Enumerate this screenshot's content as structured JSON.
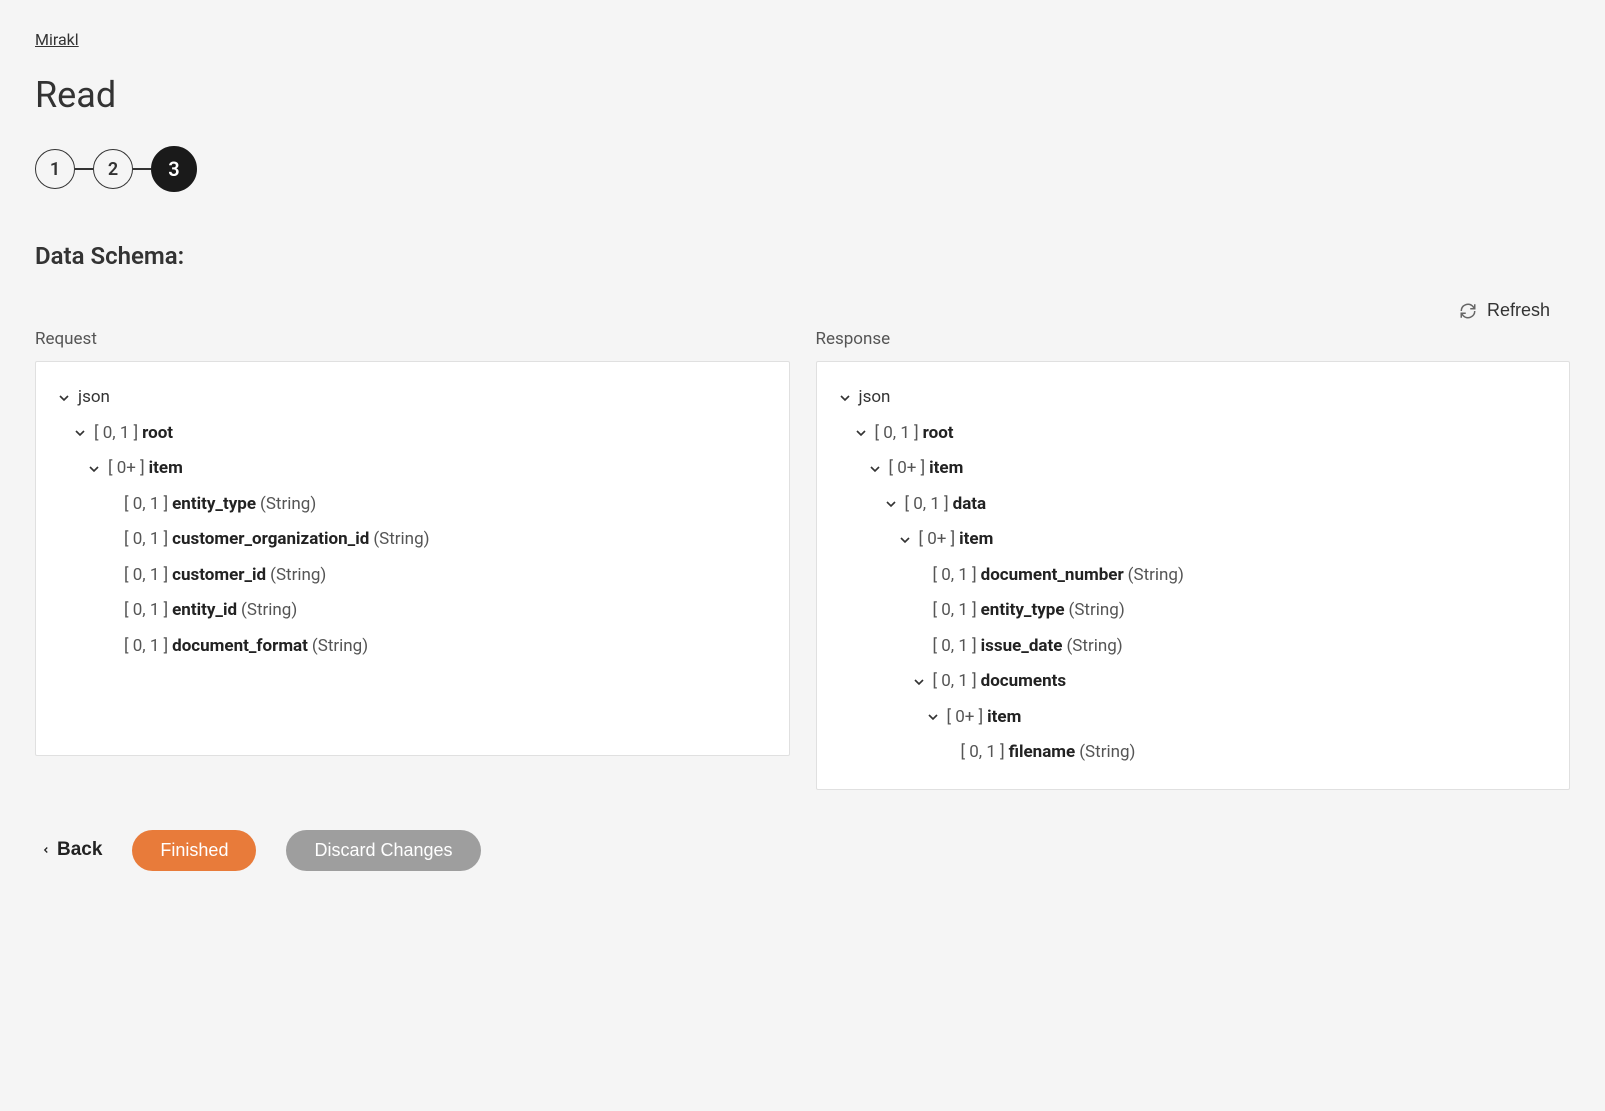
{
  "breadcrumb": {
    "label": "Mirakl"
  },
  "page_title": "Read",
  "steps": [
    "1",
    "2",
    "3"
  ],
  "active_step": 2,
  "section_title": "Data Schema:",
  "refresh_label": "Refresh",
  "request_label": "Request",
  "response_label": "Response",
  "request_tree": {
    "root_label": "json",
    "n0": {
      "card": "[ 0, 1 ]",
      "name": "root"
    },
    "n1": {
      "card": "[ 0+ ]",
      "name": "item"
    },
    "n2": {
      "card": "[ 0, 1 ]",
      "name": "entity_type",
      "type": "(String)"
    },
    "n3": {
      "card": "[ 0, 1 ]",
      "name": "customer_organization_id",
      "type": "(String)"
    },
    "n4": {
      "card": "[ 0, 1 ]",
      "name": "customer_id",
      "type": "(String)"
    },
    "n5": {
      "card": "[ 0, 1 ]",
      "name": "entity_id",
      "type": "(String)"
    },
    "n6": {
      "card": "[ 0, 1 ]",
      "name": "document_format",
      "type": "(String)"
    }
  },
  "response_tree": {
    "root_label": "json",
    "n0": {
      "card": "[ 0, 1 ]",
      "name": "root"
    },
    "n1": {
      "card": "[ 0+ ]",
      "name": "item"
    },
    "n2": {
      "card": "[ 0, 1 ]",
      "name": "data"
    },
    "n3": {
      "card": "[ 0+ ]",
      "name": "item"
    },
    "n4": {
      "card": "[ 0, 1 ]",
      "name": "document_number",
      "type": "(String)"
    },
    "n5": {
      "card": "[ 0, 1 ]",
      "name": "entity_type",
      "type": "(String)"
    },
    "n6": {
      "card": "[ 0, 1 ]",
      "name": "issue_date",
      "type": "(String)"
    },
    "n7": {
      "card": "[ 0, 1 ]",
      "name": "documents"
    },
    "n8": {
      "card": "[ 0+ ]",
      "name": "item"
    },
    "n9": {
      "card": "[ 0, 1 ]",
      "name": "filename",
      "type": "(String)"
    }
  },
  "footer": {
    "back": "Back",
    "finished": "Finished",
    "discard": "Discard Changes"
  }
}
